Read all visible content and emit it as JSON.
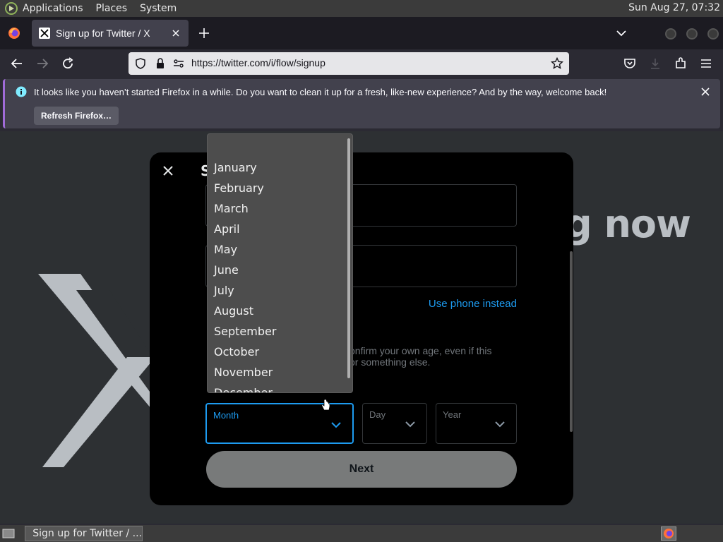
{
  "panel": {
    "menus": [
      "Applications",
      "Places",
      "System"
    ],
    "clock": "Sun Aug 27, 07:32"
  },
  "browser": {
    "tab_title": "Sign up for Twitter / X",
    "url": "https://twitter.com/i/flow/signup",
    "notification": {
      "message": "It looks like you haven’t started Firefox in a while. Do you want to clean it up for a fresh, like-new experience? And by the way, welcome back!",
      "button_label": "Refresh Firefox…"
    }
  },
  "page": {
    "background_headline": "g now",
    "modal": {
      "title_fragment": "S",
      "use_phone_link": "Use phone instead",
      "dob_text_line1": "onfirm your own age, even if this",
      "dob_text_line2": "or something else.",
      "month_label": "Month",
      "day_label": "Day",
      "year_label": "Year",
      "next_button": "Next"
    },
    "month_dropdown": {
      "options": [
        "January",
        "February",
        "March",
        "April",
        "May",
        "June",
        "July",
        "August",
        "September",
        "October",
        "November",
        "December"
      ]
    }
  },
  "taskbar": {
    "task_label": "Sign up for Twitter / ..."
  },
  "colors": {
    "accent_blue": "#1d9bf0",
    "modal_bg": "#000000",
    "next_button_bg": "#787a7a",
    "dropdown_bg": "#4d4d4d"
  }
}
